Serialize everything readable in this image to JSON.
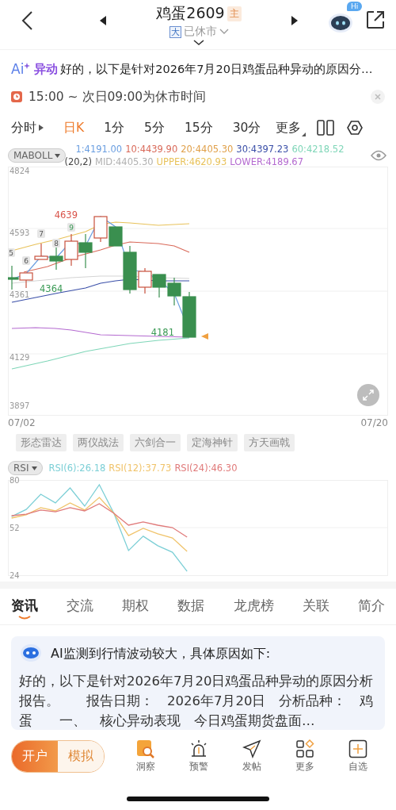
{
  "header": {
    "title": "鸡蛋2609",
    "badge": "主",
    "status_icon": "大",
    "status": "已休市",
    "assistant_badge": "Hi"
  },
  "ai_alert": {
    "logo": "Ai",
    "tag": "异动",
    "message": "好的，以下是针对2026年7月20日鸡蛋品种异动的原因分…"
  },
  "notice": {
    "text": "15:00 ~ 次日09:00为休市时间"
  },
  "period_tabs": [
    {
      "label": "分时",
      "kind": "submenu",
      "selected": false
    },
    {
      "label": "日K",
      "kind": "plain",
      "selected": true
    },
    {
      "label": "1分",
      "kind": "plain",
      "selected": false
    },
    {
      "label": "5分",
      "kind": "plain",
      "selected": false
    },
    {
      "label": "15分",
      "kind": "plain",
      "selected": false
    },
    {
      "label": "30分",
      "kind": "plain",
      "selected": false
    },
    {
      "label": "更多",
      "kind": "dropdown",
      "selected": false
    }
  ],
  "main_indicator": {
    "name": "MABOLL",
    "ma_values": [
      {
        "text": "1:4191.00",
        "color": "#6a9ee0"
      },
      {
        "text": "10:4439.90",
        "color": "#d96a5a"
      },
      {
        "text": "20:4405.30",
        "color": "#e0a04a"
      },
      {
        "text": "30:4397.23",
        "color": "#3a4fa8"
      },
      {
        "text": "60:4218.52",
        "color": "#7fd6b8"
      }
    ],
    "boll_values": [
      {
        "text": "(20,2)",
        "color": "#444444"
      },
      {
        "text": "MID:4405.30",
        "color": "#b0b0b0"
      },
      {
        "text": "UPPER:4620.93",
        "color": "#e8c25a"
      },
      {
        "text": "LOWER:4189.67",
        "color": "#b46ad0"
      }
    ]
  },
  "kline": {
    "tick_labels": [
      "4824",
      "4593",
      "4361",
      "4129",
      "3897"
    ],
    "markers": [
      {
        "text": "5",
        "kind": "plain"
      },
      {
        "text": "6",
        "kind": "plain"
      },
      {
        "text": "7",
        "kind": "plain"
      },
      {
        "text": "8",
        "kind": "plain"
      },
      {
        "text": "9",
        "kind": "highlight"
      }
    ],
    "price_labels": [
      {
        "text": "4639",
        "kind": "high"
      },
      {
        "text": "4364",
        "kind": "low"
      },
      {
        "text": "4181",
        "kind": "low"
      }
    ],
    "dates": [
      "07/02",
      "07/20"
    ]
  },
  "strategies": [
    "形态雷达",
    "两仪战法",
    "六剑合一",
    "定海神针",
    "方天画戟"
  ],
  "sub_indicator": {
    "name": "RSI",
    "readings": [
      ":26.18",
      ":37.73",
      ":46.30"
    ],
    "chart_data": {
      "type": "line",
      "categories": [
        null,
        null,
        null,
        null,
        null,
        null,
        null,
        null,
        null,
        null,
        null,
        null,
        null,
        null,
        null,
        null,
        null,
        null,
        null,
        null,
        null,
        null,
        null,
        null,
        null,
        null
      ],
      "ylim": [
        24,
        80
      ],
      "yticks": [
        80,
        52,
        24
      ],
      "series": [
        {
          "name": "RSI(6)",
          "color": "#7ccfd6",
          "values": [
            58.5,
            62.7,
            71.6,
            66.5,
            75.3,
            64.6,
            77.2,
            60.4,
            38.5,
            46.9,
            41.3,
            37.5,
            26.3,
            null,
            null,
            null,
            null,
            null,
            null,
            null,
            null,
            null,
            null,
            null,
            null,
            null
          ]
        },
        {
          "name": "RSI(12)",
          "color": "#f0c36a",
          "values": [
            57.6,
            59.5,
            63.7,
            61.8,
            66.5,
            62.3,
            69.7,
            60.4,
            47.3,
            51.6,
            48.3,
            45.9,
            38.0,
            null,
            null,
            null,
            null,
            null,
            null,
            null,
            null,
            null,
            null,
            null,
            null,
            null
          ]
        },
        {
          "name": "RSI(24)",
          "color": "#e07a7a",
          "values": [
            59.0,
            59.9,
            62.3,
            61.3,
            63.7,
            61.8,
            66.0,
            60.4,
            53.4,
            55.3,
            53.4,
            52.0,
            46.4,
            null,
            null,
            null,
            null,
            null,
            null,
            null,
            null,
            null,
            null,
            null,
            null,
            null
          ]
        }
      ]
    }
  },
  "info_tabs": [
    {
      "label": "资讯",
      "selected": true
    },
    {
      "label": "交流",
      "selected": false
    },
    {
      "label": "期权",
      "selected": false
    },
    {
      "label": "数据",
      "selected": false
    },
    {
      "label": "龙虎榜",
      "selected": false
    },
    {
      "label": "关联",
      "selected": false
    },
    {
      "label": "简介",
      "selected": false
    }
  ],
  "ai_card": {
    "title": "AI监测到行情波动较大，具体原因如下:",
    "body": "好的，以下是针对2026年7月20日鸡蛋品种异动的原因分析报告。　　报告日期：　2026年7月20日　分析品种：　鸡蛋　　一、　核心异动表现　今日鸡蛋期货盘面…"
  },
  "actions": [
    {
      "label": "开户",
      "kind": "primary"
    },
    {
      "label": "模拟",
      "kind": "secondary"
    }
  ],
  "nav": [
    {
      "label": "洞察",
      "kind": "insight"
    },
    {
      "label": "预警",
      "kind": "alarm"
    },
    {
      "label": "发帖",
      "kind": "post"
    },
    {
      "label": "更多",
      "kind": "more"
    },
    {
      "label": "自选",
      "kind": "add"
    }
  ]
}
